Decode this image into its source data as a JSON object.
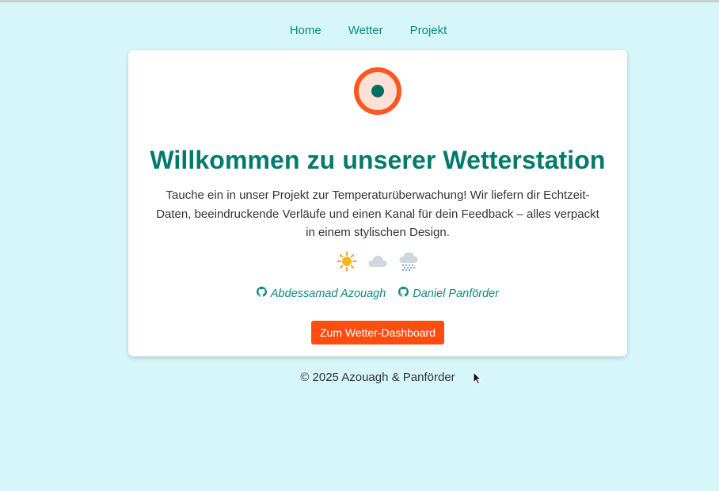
{
  "nav": {
    "items": [
      {
        "label": "Home"
      },
      {
        "label": "Wetter"
      },
      {
        "label": "Projekt"
      }
    ]
  },
  "hero": {
    "title": "Willkommen zu unserer Wetterstation",
    "description": "Tauche ein in unser Projekt zur Temperaturüberwachung! Wir liefern dir Echtzeit-Daten, beeindruckende Verläufe und einen Kanal für dein Feedback – alles verpackt in einem stylischen Design.",
    "weather_icons": [
      "sun-icon",
      "cloud-icon",
      "snow-cloud-icon"
    ]
  },
  "authors": [
    {
      "name": "Abdessamad Azouagh",
      "icon": "github-icon"
    },
    {
      "name": "Daniel Panförder",
      "icon": "github-icon"
    }
  ],
  "cta": {
    "label": "Zum Wetter-Dashboard"
  },
  "footer": {
    "text": "© 2025 Azouagh & Panförder"
  },
  "colors": {
    "background": "#d7f6fa",
    "accent": "#007a6c",
    "link": "#0b8a7d",
    "button": "#ff4d12",
    "logo_ring": "#ff5722",
    "logo_fill": "#fde0d6"
  }
}
